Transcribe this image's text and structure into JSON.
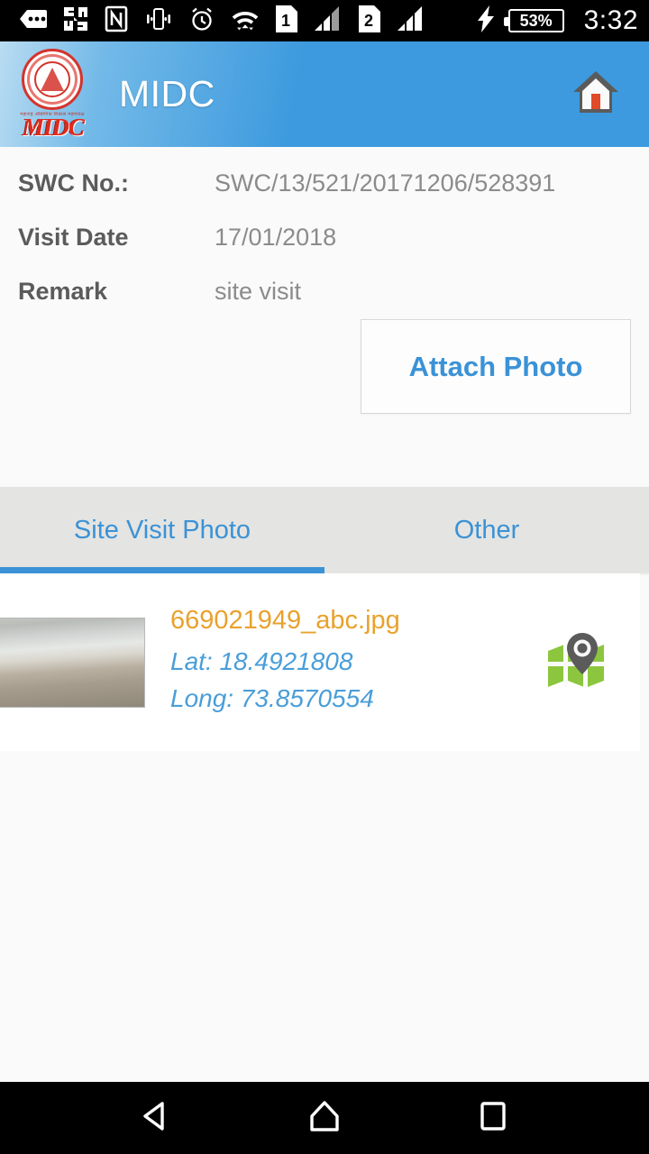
{
  "status_bar": {
    "time": "3:32",
    "battery_percent": "53%",
    "sim1_label": "1",
    "sim2_label": "2",
    "icons": [
      "more-notifications-icon",
      "app-pinwheel-icon",
      "nfc-icon",
      "vibrate-icon",
      "alarm-icon",
      "wifi-icon",
      "sim1-icon",
      "signal1-icon",
      "sim2-icon",
      "signal2-icon",
      "charging-bolt-icon",
      "battery-icon"
    ]
  },
  "header": {
    "title": "MIDC",
    "logo_wordmark": "MIDC",
    "logo_arc_text": "महाराष्ट्र औद्योगिक विकास महामंडळ",
    "home_icon": "home-icon"
  },
  "form": {
    "fields": [
      {
        "label": "SWC No.:",
        "value": "SWC/13/521/20171206/528391"
      },
      {
        "label": "Visit Date",
        "value": "17/01/2018"
      },
      {
        "label": "Remark",
        "value": "site visit"
      }
    ],
    "attach_button": "Attach Photo"
  },
  "tabs": [
    {
      "label": "Site Visit Photo",
      "active": true
    },
    {
      "label": "Other",
      "active": false
    }
  ],
  "photo_list": [
    {
      "filename": "669021949_abc.jpg",
      "lat": "Lat: 18.4921808",
      "long": "Long: 73.8570554",
      "thumbnail_alt": "site-photo-thumbnail",
      "map_icon": "map-location-icon"
    }
  ],
  "nav_bar": {
    "back": "back-button",
    "home": "home-button",
    "recents": "recents-button"
  },
  "colors": {
    "header_blue": "#3d9ade",
    "accent_blue": "#3b92d6",
    "filename_orange": "#e8a22d",
    "geo_blue": "#4a9ed8",
    "label_gray": "#5b5b5b",
    "value_gray": "#8b8b8b",
    "logo_red": "#e02b1d",
    "map_green": "#8cc63f",
    "tab_bg": "#e4e4e2"
  }
}
